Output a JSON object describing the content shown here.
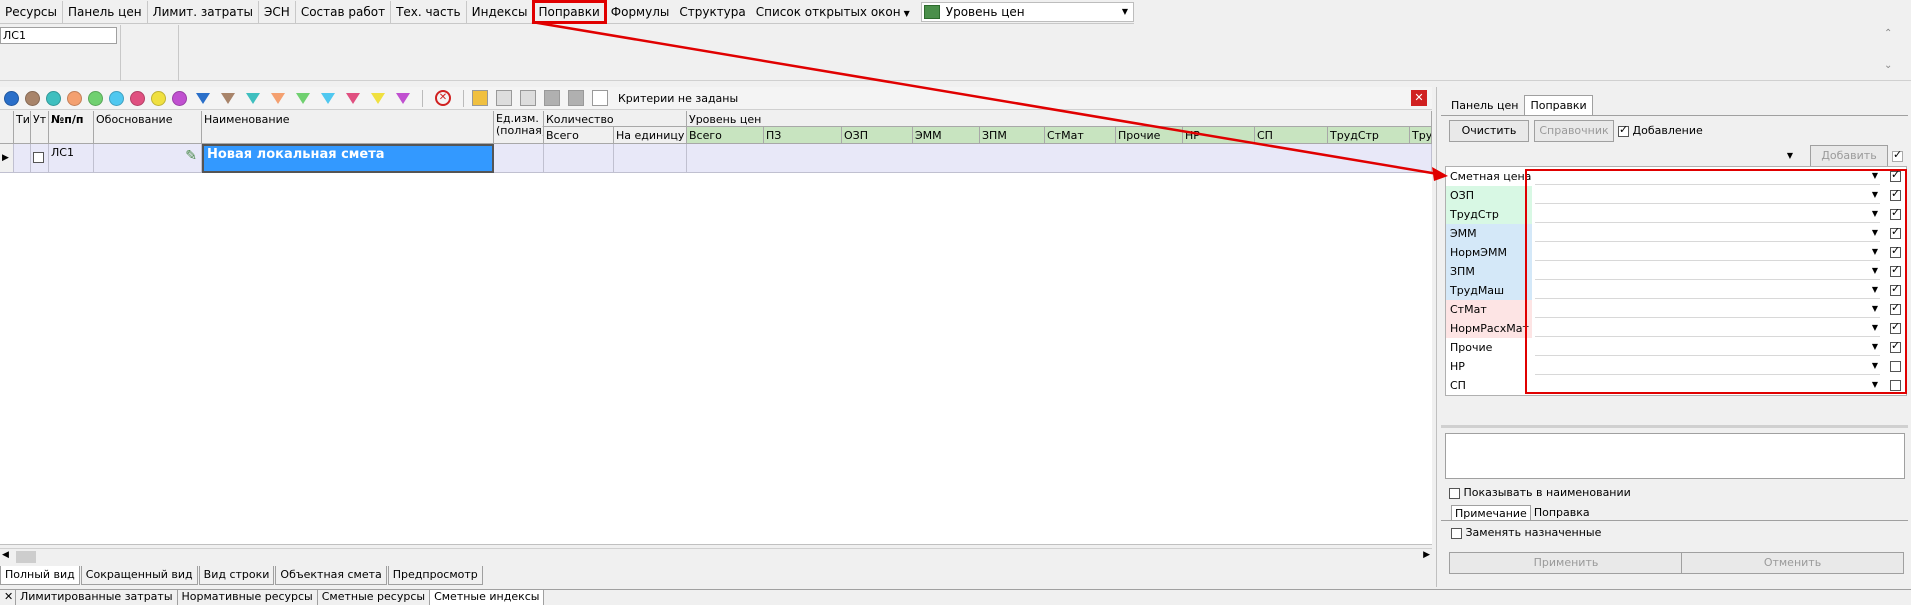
{
  "toolbar": {
    "items": [
      "Ресурсы",
      "Панель цен",
      "Лимит. затраты",
      "ЭСН",
      "Состав работ",
      "Тех. часть",
      "Индексы",
      "Поправки",
      "Формулы",
      "Структура"
    ],
    "open_windows_label": "Список открытых окон",
    "price_level_value": "Уровень цен",
    "highlight_color": "#e00000"
  },
  "header_field": {
    "value": "ЛС1"
  },
  "grid_toolbar": {
    "criteria_text": "Критерии не заданы"
  },
  "grid": {
    "headers": {
      "ti": "Ти",
      "ut": "Ут",
      "num": "№п/п",
      "basis": "Обоснование",
      "name": "Наименование",
      "unit": "Ед.изм. (полная)",
      "qty": "Количество",
      "qty_total": "Всего",
      "qty_unit": "На единицу",
      "price_level": "Уровень цен",
      "price_cols": [
        "Всего",
        "ПЗ",
        "ОЗП",
        "ЭММ",
        "ЗПМ",
        "СтМат",
        "Прочие",
        "НР",
        "СП",
        "ТрудСтр",
        "Тру"
      ]
    },
    "row": {
      "num": "ЛС1",
      "name": "Новая локальная смета"
    }
  },
  "view_tabs": [
    "Полный вид",
    "Сокращенный вид",
    "Вид строки",
    "Объектная смета",
    "Предпросмотр"
  ],
  "bottom_tabs": [
    "Лимитированные затраты",
    "Нормативные ресурсы",
    "Сметные ресурсы",
    "Сметные индексы"
  ],
  "right_panel": {
    "tabs": [
      "Панель цен",
      "Поправки"
    ],
    "clear_button": "Очистить",
    "reference_button": "Справочник",
    "add_mode_label": "Добавление",
    "add_button": "Добавить",
    "corrections": [
      {
        "label": "Сметная цена",
        "checked": true,
        "color": "#ffffff"
      },
      {
        "label": "ОЗП",
        "checked": true,
        "color": "#d8f8e4"
      },
      {
        "label": "ТрудСтр",
        "checked": true,
        "color": "#d8f8e4"
      },
      {
        "label": "ЭММ",
        "checked": true,
        "color": "#d4e8f8"
      },
      {
        "label": "НормЭММ",
        "checked": true,
        "color": "#d4e8f8"
      },
      {
        "label": "ЗПМ",
        "checked": true,
        "color": "#d4e8f8"
      },
      {
        "label": "ТрудМаш",
        "checked": true,
        "color": "#d4e8f8"
      },
      {
        "label": "СтМат",
        "checked": true,
        "color": "#fde4e4"
      },
      {
        "label": "НормРасхМат",
        "checked": true,
        "color": "#fde4e4"
      },
      {
        "label": "Прочие",
        "checked": true,
        "color": "#ffffff"
      },
      {
        "label": "НР",
        "checked": false,
        "color": "#ffffff"
      },
      {
        "label": "СП",
        "checked": false,
        "color": "#ffffff"
      }
    ],
    "show_in_name_label": "Показывать в наименовании",
    "sub_tabs": [
      "Примечание",
      "Поправка"
    ],
    "replace_assigned_label": "Заменять назначенные",
    "apply_button": "Применить",
    "cancel_button": "Отменить"
  }
}
